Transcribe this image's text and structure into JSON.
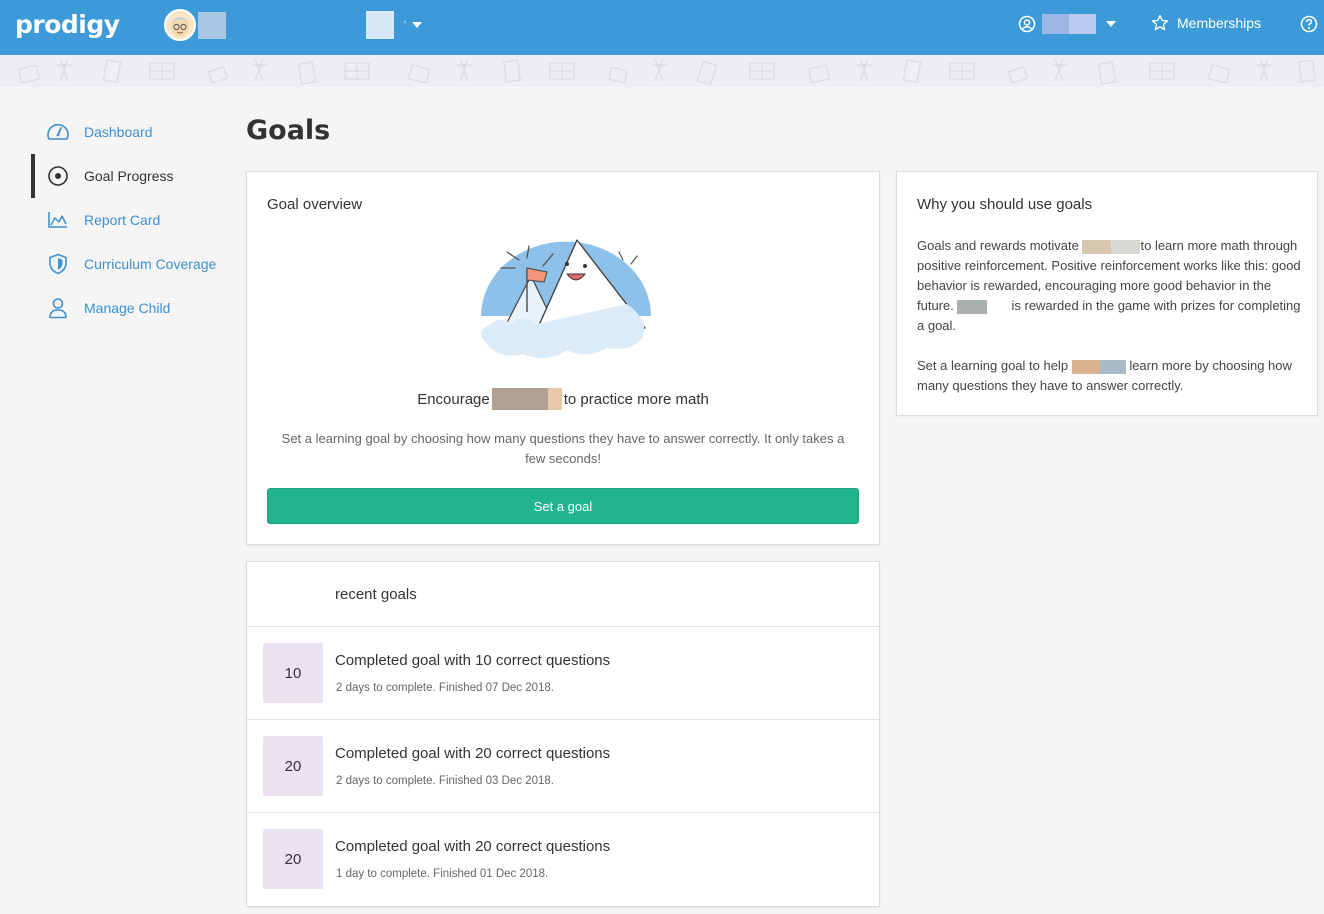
{
  "header": {
    "logo": "prodigy",
    "memberships_label": "Memberships"
  },
  "sidebar": {
    "items": [
      {
        "label": "Dashboard",
        "icon": "speedometer-icon"
      },
      {
        "label": "Goal Progress",
        "icon": "target-icon",
        "active": true
      },
      {
        "label": "Report Card",
        "icon": "chart-icon"
      },
      {
        "label": "Curriculum Coverage",
        "icon": "shield-icon"
      },
      {
        "label": "Manage Child",
        "icon": "person-icon"
      }
    ]
  },
  "main": {
    "title": "Goals",
    "overview": {
      "title": "Goal overview",
      "encourage_before": "Encourage",
      "encourage_after": "to practice more math",
      "description": "Set a learning goal by choosing how many questions they have to answer correctly. It only takes a few seconds!",
      "button": "Set a goal"
    },
    "recent": {
      "title": "recent goals",
      "goals": [
        {
          "count": "10",
          "title": "Completed goal with 10 correct questions",
          "subtitle": "2 days to complete. Finished 07 Dec 2018."
        },
        {
          "count": "20",
          "title": "Completed goal with 20 correct questions",
          "subtitle": "2 days to complete. Finished 03 Dec 2018."
        },
        {
          "count": "20",
          "title": "Completed goal with 20 correct questions",
          "subtitle": "1 day to complete. Finished 01 Dec 2018."
        }
      ]
    },
    "why": {
      "title": "Why you should use goals",
      "p1_a": "Goals and rewards motivate",
      "p1_b": "to learn more math through positive reinforcement. Positive reinforcement works like this: good behavior is rewarded, encouraging more good behavior in the future.",
      "p1_c": "is rewarded in the game with prizes for completing a goal.",
      "p2_a": "Set a learning goal to help",
      "p2_b": "learn more by choosing how many questions they have to answer correctly."
    }
  },
  "colors": {
    "header": "#3d9ad9",
    "link": "#3d8fd0",
    "primary_button": "#22b38f",
    "goal_badge": "#ebe2f1"
  }
}
